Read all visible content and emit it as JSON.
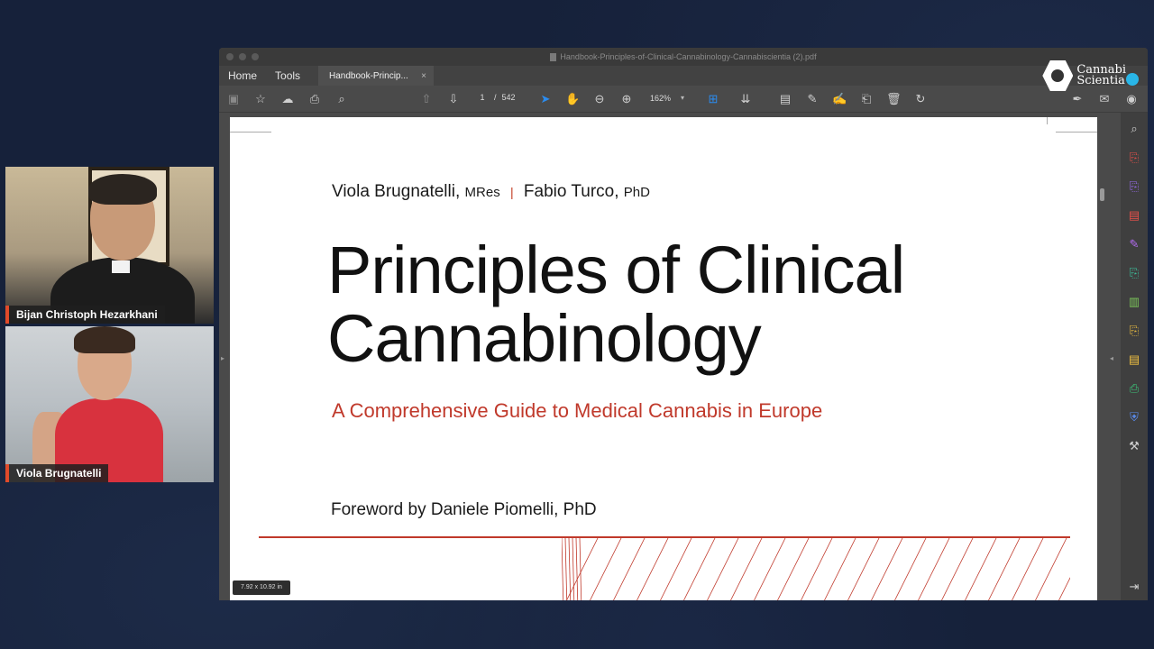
{
  "participants": [
    {
      "name": "Bijan Christoph Hezarkhani"
    },
    {
      "name": "Viola Brugnatelli"
    }
  ],
  "window": {
    "title": "Handbook-Principles-of-Clinical-Cannabinology-Cannabiscientia (2).pdf"
  },
  "menu": {
    "home": "Home",
    "tools": "Tools"
  },
  "tab": {
    "label": "Handbook-Princip...",
    "close": "×"
  },
  "logo": {
    "line1": "Cannabi",
    "line2": "Scientia"
  },
  "toolbar": {
    "page_current": "1",
    "page_separator": "/",
    "page_total": "542",
    "zoom": "162%"
  },
  "document": {
    "author1": "Viola Brugnatelli,",
    "author1_suffix": "MRes",
    "separator": "|",
    "author2": "Fabio Turco,",
    "author2_suffix": "PhD",
    "title_line1": "Principles of Clinical",
    "title_line2": "Cannabinology",
    "subtitle": "A Comprehensive Guide to Medical Cannabis in Europe",
    "foreword": "Foreword by Daniele Piomelli, PhD",
    "page_size": "7.92 x 10.92 in"
  },
  "colors": {
    "accent_red": "#c0392b",
    "select_blue": "#2b8cf0",
    "logo_dot": "#29b6e8",
    "name_tag_accent": "#e04a2a"
  }
}
